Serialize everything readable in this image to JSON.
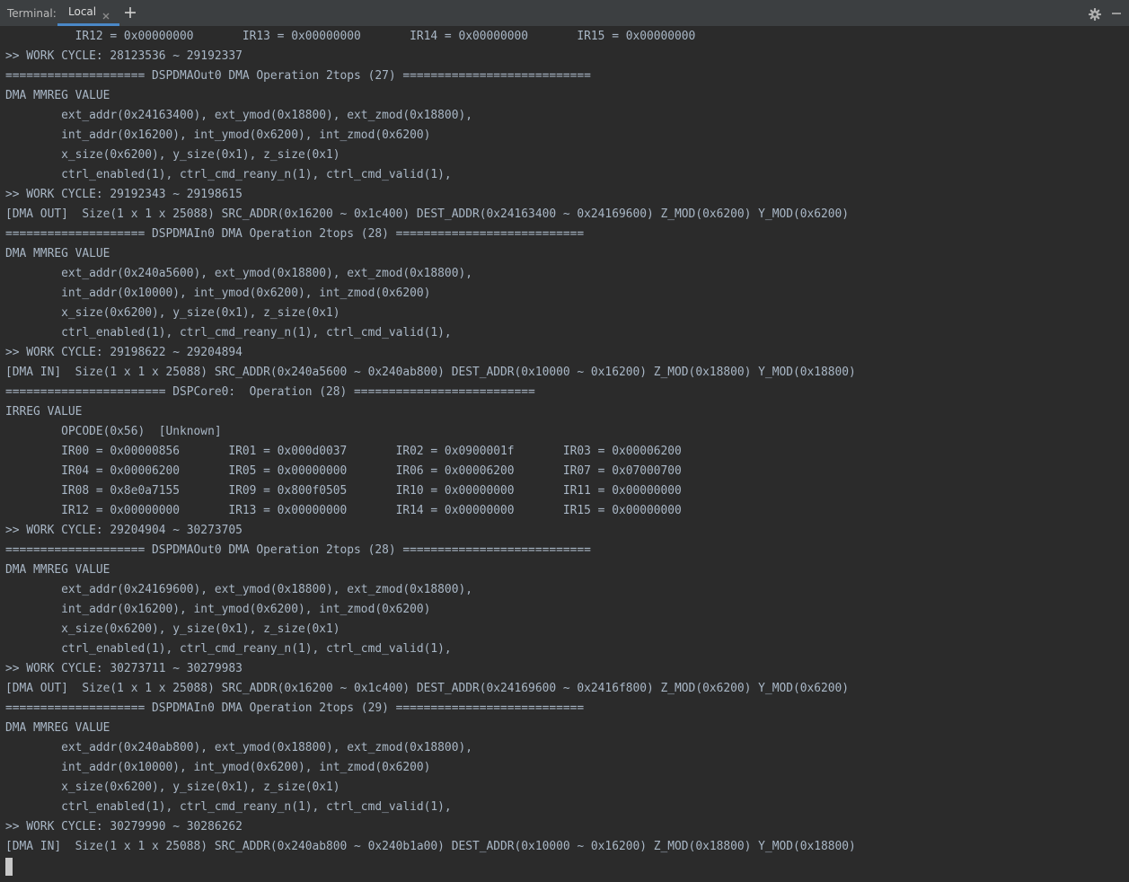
{
  "tabbar": {
    "title": "Terminal:",
    "tab_label": "Local",
    "icons": {
      "close": "close-icon",
      "add": "plus-icon",
      "settings": "gear-icon",
      "minimize": "minimize-icon"
    }
  },
  "colors": {
    "background": "#2b2b2b",
    "text": "#a9b7c6",
    "tab_underline": "#4a88c7"
  },
  "terminal": {
    "lines": [
      "          IR12 = 0x00000000       IR13 = 0x00000000       IR14 = 0x00000000       IR15 = 0x00000000",
      ">> WORK CYCLE: 28123536 ~ 29192337",
      "==================== DSPDMAOut0 DMA Operation 2tops (27) ===========================",
      "DMA MMREG VALUE",
      "        ext_addr(0x24163400), ext_ymod(0x18800), ext_zmod(0x18800),",
      "        int_addr(0x16200), int_ymod(0x6200), int_zmod(0x6200)",
      "        x_size(0x6200), y_size(0x1), z_size(0x1)",
      "        ctrl_enabled(1), ctrl_cmd_reany_n(1), ctrl_cmd_valid(1),",
      ">> WORK CYCLE: 29192343 ~ 29198615",
      "[DMA OUT]  Size(1 x 1 x 25088) SRC_ADDR(0x16200 ~ 0x1c400) DEST_ADDR(0x24163400 ~ 0x24169600) Z_MOD(0x6200) Y_MOD(0x6200)",
      "==================== DSPDMAIn0 DMA Operation 2tops (28) ===========================",
      "DMA MMREG VALUE",
      "        ext_addr(0x240a5600), ext_ymod(0x18800), ext_zmod(0x18800),",
      "        int_addr(0x10000), int_ymod(0x6200), int_zmod(0x6200)",
      "        x_size(0x6200), y_size(0x1), z_size(0x1)",
      "        ctrl_enabled(1), ctrl_cmd_reany_n(1), ctrl_cmd_valid(1),",
      ">> WORK CYCLE: 29198622 ~ 29204894",
      "[DMA IN]  Size(1 x 1 x 25088) SRC_ADDR(0x240a5600 ~ 0x240ab800) DEST_ADDR(0x10000 ~ 0x16200) Z_MOD(0x18800) Y_MOD(0x18800)",
      "======================= DSPCore0:  Operation (28) ==========================",
      "IRREG VALUE",
      "        OPCODE(0x56)  [Unknown]",
      "        IR00 = 0x00000856       IR01 = 0x000d0037       IR02 = 0x0900001f       IR03 = 0x00006200",
      "        IR04 = 0x00006200       IR05 = 0x00000000       IR06 = 0x00006200       IR07 = 0x07000700",
      "        IR08 = 0x8e0a7155       IR09 = 0x800f0505       IR10 = 0x00000000       IR11 = 0x00000000",
      "        IR12 = 0x00000000       IR13 = 0x00000000       IR14 = 0x00000000       IR15 = 0x00000000",
      ">> WORK CYCLE: 29204904 ~ 30273705",
      "==================== DSPDMAOut0 DMA Operation 2tops (28) ===========================",
      "DMA MMREG VALUE",
      "        ext_addr(0x24169600), ext_ymod(0x18800), ext_zmod(0x18800),",
      "        int_addr(0x16200), int_ymod(0x6200), int_zmod(0x6200)",
      "        x_size(0x6200), y_size(0x1), z_size(0x1)",
      "        ctrl_enabled(1), ctrl_cmd_reany_n(1), ctrl_cmd_valid(1),",
      ">> WORK CYCLE: 30273711 ~ 30279983",
      "[DMA OUT]  Size(1 x 1 x 25088) SRC_ADDR(0x16200 ~ 0x1c400) DEST_ADDR(0x24169600 ~ 0x2416f800) Z_MOD(0x6200) Y_MOD(0x6200)",
      "==================== DSPDMAIn0 DMA Operation 2tops (29) ===========================",
      "DMA MMREG VALUE",
      "        ext_addr(0x240ab800), ext_ymod(0x18800), ext_zmod(0x18800),",
      "        int_addr(0x10000), int_ymod(0x6200), int_zmod(0x6200)",
      "        x_size(0x6200), y_size(0x1), z_size(0x1)",
      "        ctrl_enabled(1), ctrl_cmd_reany_n(1), ctrl_cmd_valid(1),",
      ">> WORK CYCLE: 30279990 ~ 30286262",
      "[DMA IN]  Size(1 x 1 x 25088) SRC_ADDR(0x240ab800 ~ 0x240b1a00) DEST_ADDR(0x10000 ~ 0x16200) Z_MOD(0x18800) Y_MOD(0x18800)"
    ]
  }
}
